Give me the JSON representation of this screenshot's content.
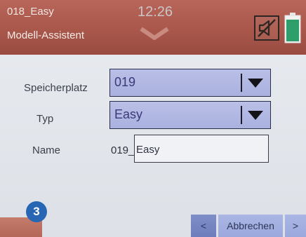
{
  "header": {
    "model_name": "018_Easy",
    "title": "Modell-Assistent",
    "time": "12:26",
    "mute_icon": "speaker-muted-icon",
    "battery_icon": "battery-icon",
    "menu_icon": "chevron-down-icon"
  },
  "form": {
    "slot_label": "Speicherplatz",
    "slot_value": "019",
    "type_label": "Typ",
    "type_value": "Easy",
    "name_label": "Name",
    "name_prefix": "019_",
    "name_value": "Easy"
  },
  "footer": {
    "step_number": "3",
    "prev_label": "<",
    "cancel_label": "Abbrechen",
    "next_label": ">"
  },
  "colors": {
    "header_bg": "#a9574b",
    "dropdown_bg": "#aab1df",
    "step_badge": "#2766b3",
    "nav_button": "#7f8ec7",
    "battery_green": "#2e9f6a"
  }
}
